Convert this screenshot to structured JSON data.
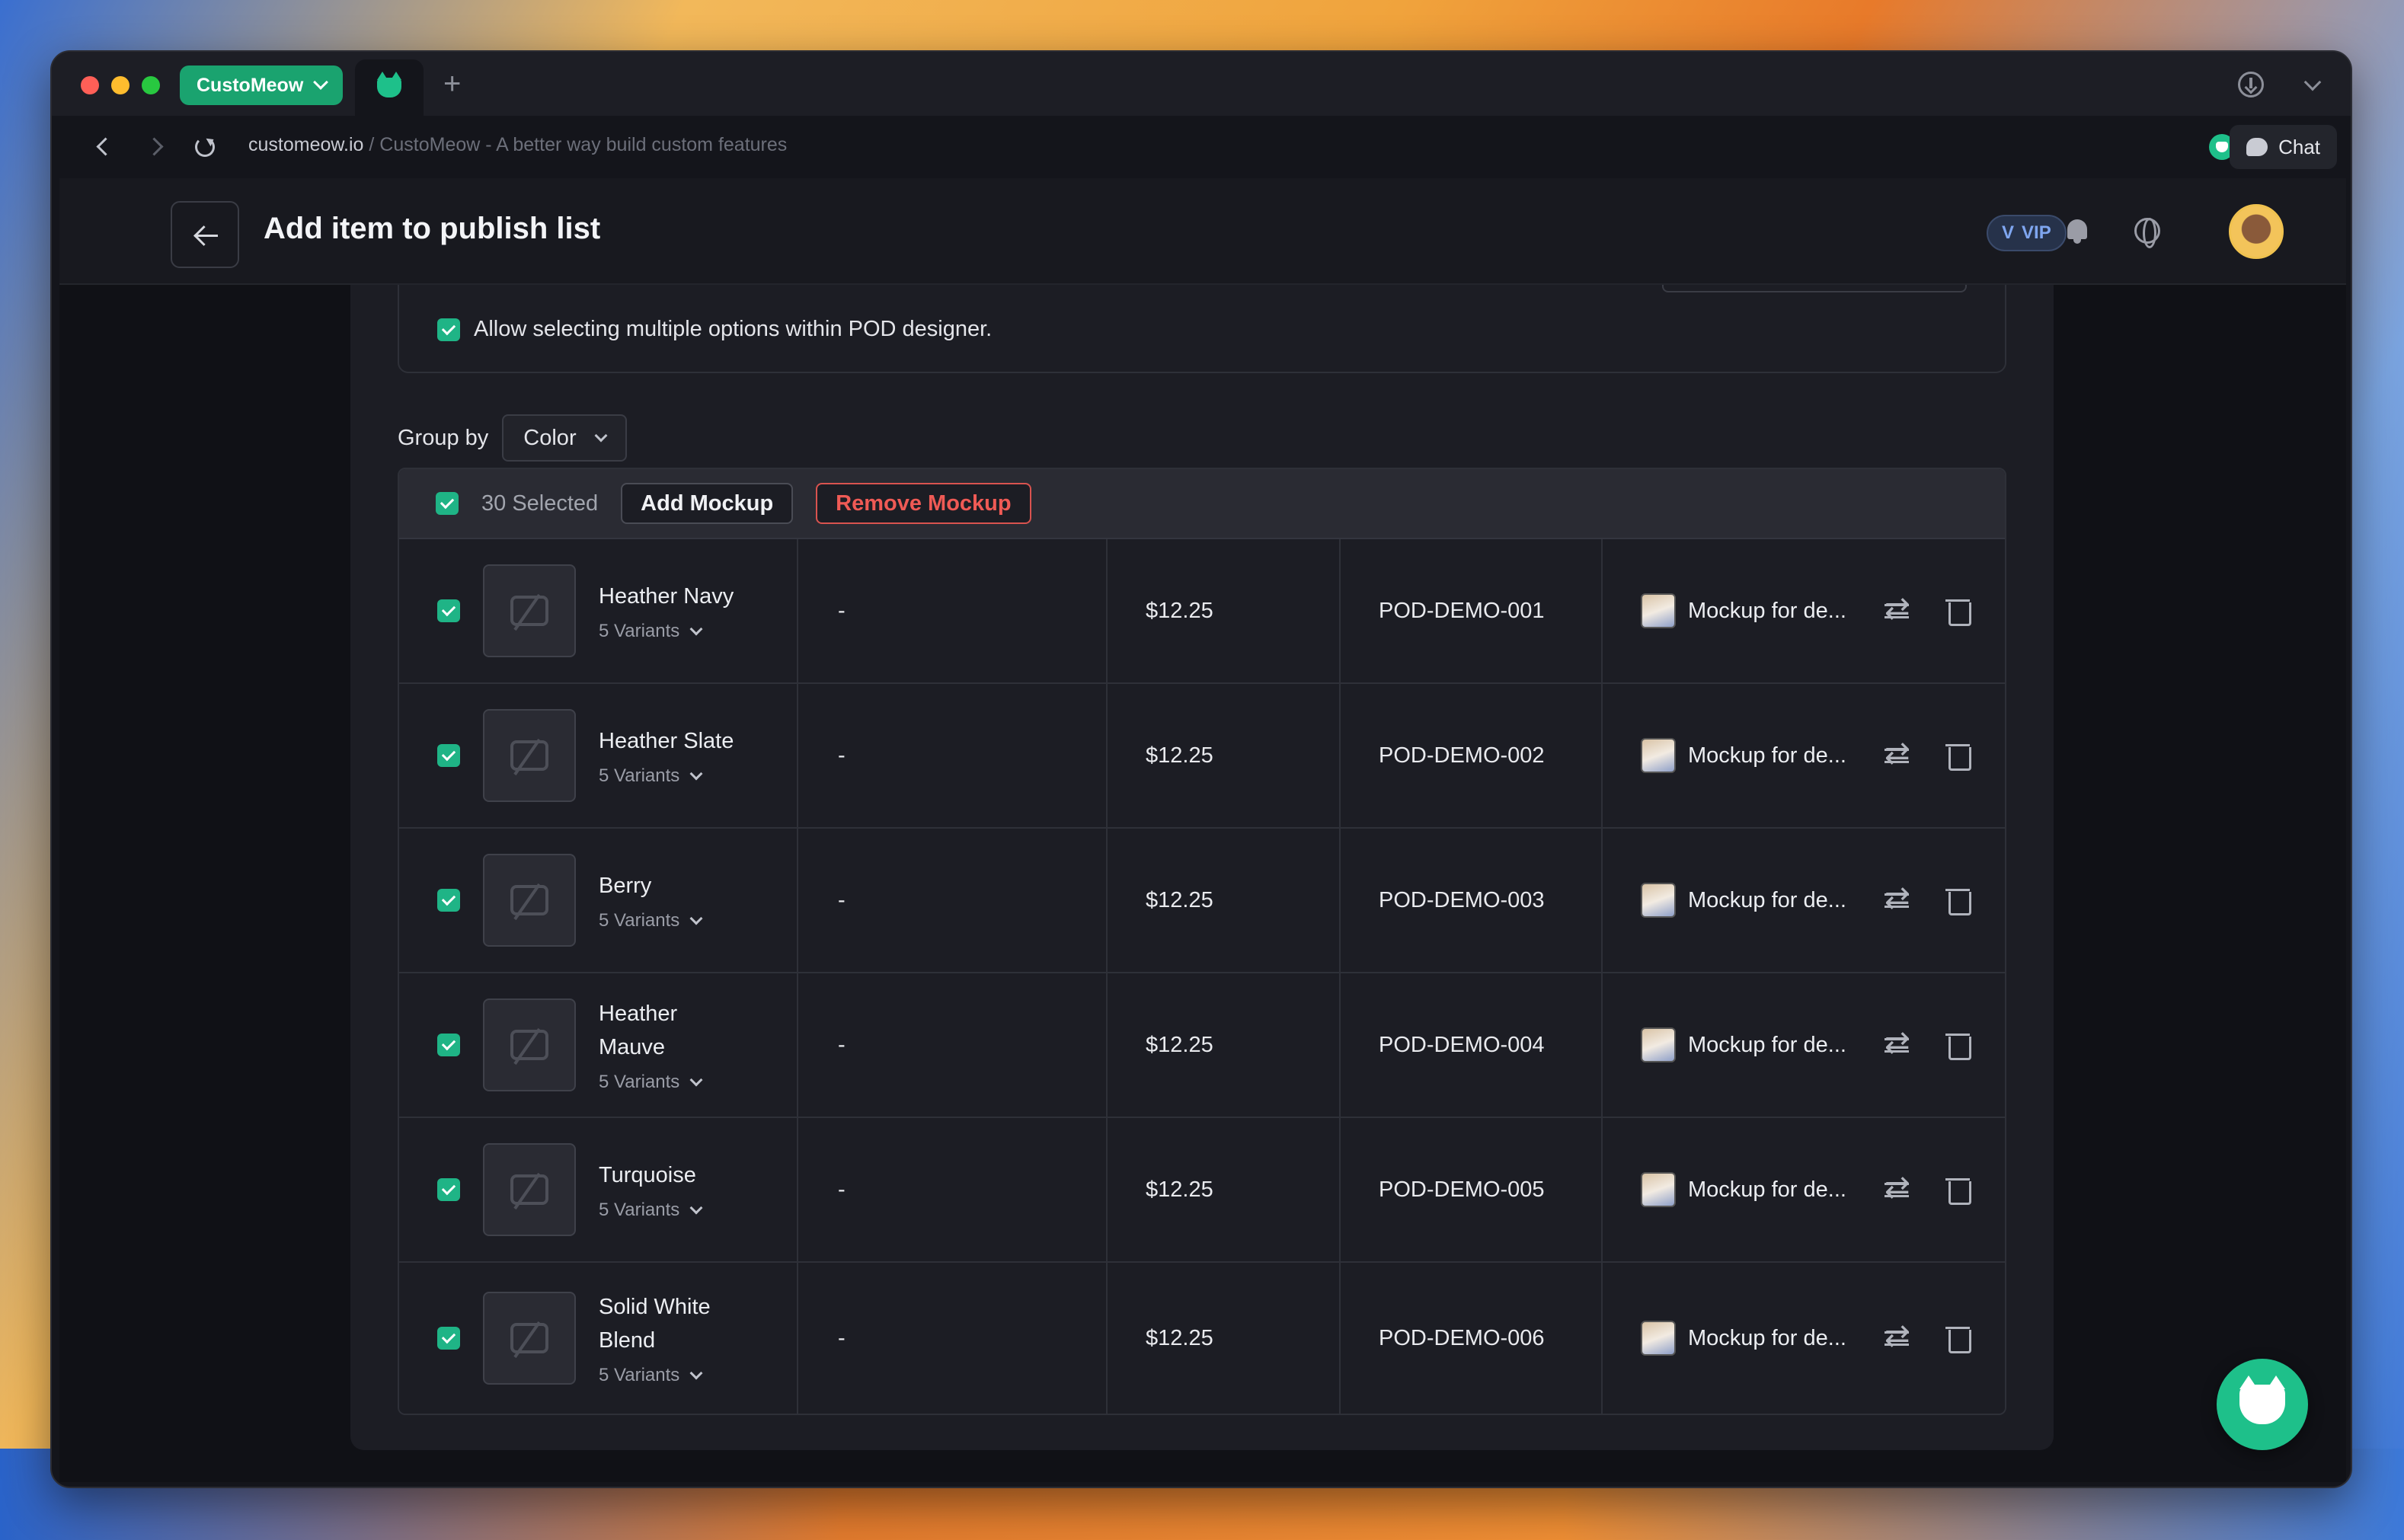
{
  "browser": {
    "workspace_label": "CustoMeow",
    "url_domain": "customeow.io",
    "url_rest": " / CustoMeow - A better way build custom features",
    "chat_label": "Chat"
  },
  "header": {
    "title": "Add item to publish list",
    "vip_label": "VIP"
  },
  "options": {
    "allow_multiple_label": "Allow selecting multiple options within POD designer.",
    "allow_multiple_checked": true
  },
  "groupby": {
    "label": "Group by",
    "value": "Color"
  },
  "toolbar": {
    "selected_text": "30 Selected",
    "add_mockup_label": "Add Mockup",
    "remove_mockup_label": "Remove Mockup"
  },
  "rows": [
    {
      "name": "Heather Navy",
      "variants": "5 Variants",
      "col2": "-",
      "price": "$12.25",
      "sku": "POD-DEMO-001",
      "mockup": "Mockup for de..."
    },
    {
      "name": "Heather Slate",
      "variants": "5 Variants",
      "col2": "-",
      "price": "$12.25",
      "sku": "POD-DEMO-002",
      "mockup": "Mockup for de..."
    },
    {
      "name": "Berry",
      "variants": "5 Variants",
      "col2": "-",
      "price": "$12.25",
      "sku": "POD-DEMO-003",
      "mockup": "Mockup for de..."
    },
    {
      "name": "Heather Mauve",
      "variants": "5 Variants",
      "col2": "-",
      "price": "$12.25",
      "sku": "POD-DEMO-004",
      "mockup": "Mockup for de..."
    },
    {
      "name": "Turquoise",
      "variants": "5 Variants",
      "col2": "-",
      "price": "$12.25",
      "sku": "POD-DEMO-005",
      "mockup": "Mockup for de..."
    },
    {
      "name": "Solid White Blend",
      "variants": "5 Variants",
      "col2": "-",
      "price": "$12.25",
      "sku": "POD-DEMO-006",
      "mockup": "Mockup for de..."
    }
  ],
  "colors": {
    "accent": "#1fb486",
    "danger": "#ef5a55",
    "vip": "#7fa6f0"
  }
}
